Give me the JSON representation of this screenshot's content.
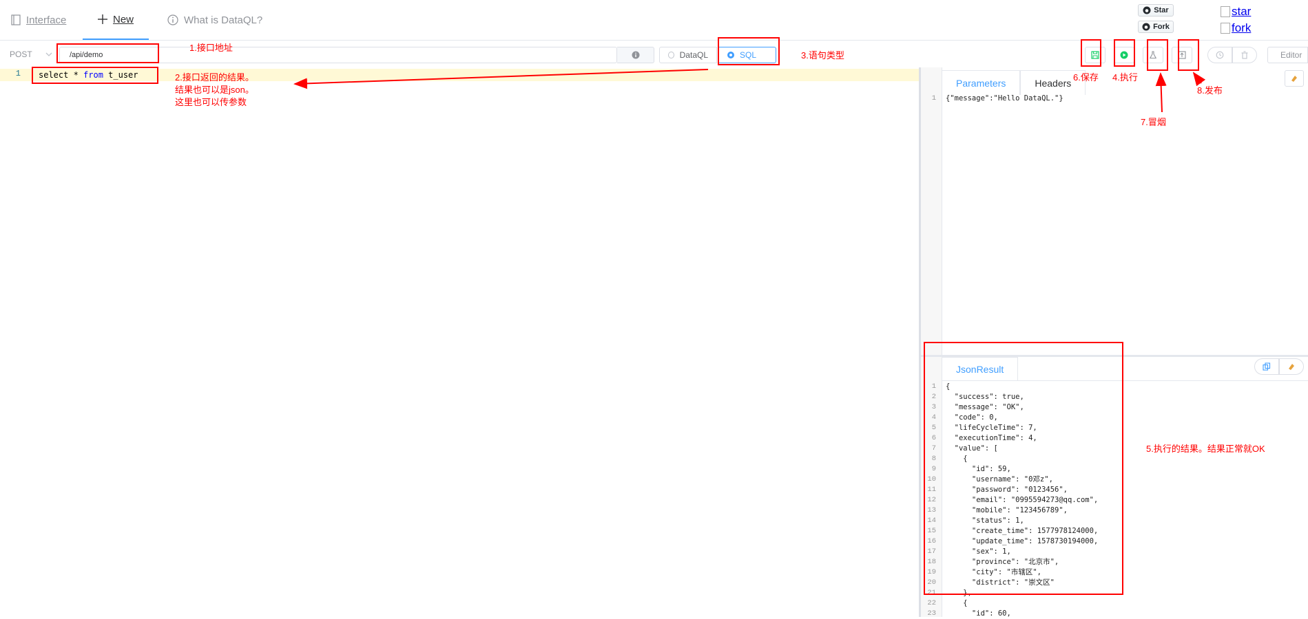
{
  "nav": {
    "tabs": [
      {
        "label": "Interface"
      },
      {
        "label": "New"
      },
      {
        "label": "What is DataQL?"
      }
    ],
    "github": {
      "star_label": "Star",
      "fork_label": "Fork"
    },
    "badges": {
      "star_alt": "star",
      "fork_alt": "fork"
    }
  },
  "toolbar": {
    "method": "POST",
    "path": "/api/demo",
    "types": [
      {
        "label": "DataQL",
        "selected": false
      },
      {
        "label": "SQL",
        "selected": true
      }
    ],
    "editor_label": "Editor"
  },
  "editor": {
    "line_number": "1",
    "code_parts": {
      "a": "select * ",
      "b": "from",
      "c": " t_user"
    }
  },
  "params_pane": {
    "tabs": [
      "Parameters",
      "Headers"
    ],
    "line_numbers": "1",
    "content": "{\"message\":\"Hello DataQL.\"}"
  },
  "result_pane": {
    "tab": "JsonResult",
    "line_numbers": "1\n2\n3\n4\n5\n6\n7\n8\n9\n10\n11\n12\n13\n14\n15\n16\n17\n18\n19\n20\n21\n22\n23",
    "content": "{\n  \"success\": true,\n  \"message\": \"OK\",\n  \"code\": 0,\n  \"lifeCycleTime\": 7,\n  \"executionTime\": 4,\n  \"value\": [\n    {\n      \"id\": 59,\n      \"username\": \"0邓z\",\n      \"password\": \"0123456\",\n      \"email\": \"0995594273@qq.com\",\n      \"mobile\": \"123456789\",\n      \"status\": 1,\n      \"create_time\": 1577978124000,\n      \"update_time\": 1578730194000,\n      \"sex\": 1,\n      \"province\": \"北京市\",\n      \"city\": \"市辖区\",\n      \"district\": \"崇文区\"\n    },\n    {\n      \"id\": 60,"
  },
  "annotations": {
    "a1": "1.接口地址",
    "a2": "2.接口返回的结果。\n结果也可以是json。\n这里也可以传参数",
    "a3": "3.语句类型",
    "a4": "4.执行",
    "a5": "5.执行的结果。结果正常就OK",
    "a6": "6.保存",
    "a7": "7.冒烟",
    "a8": "8.发布"
  },
  "colors": {
    "accent": "#409eff",
    "annotation": "#ff0000",
    "run": "#13ce66"
  }
}
